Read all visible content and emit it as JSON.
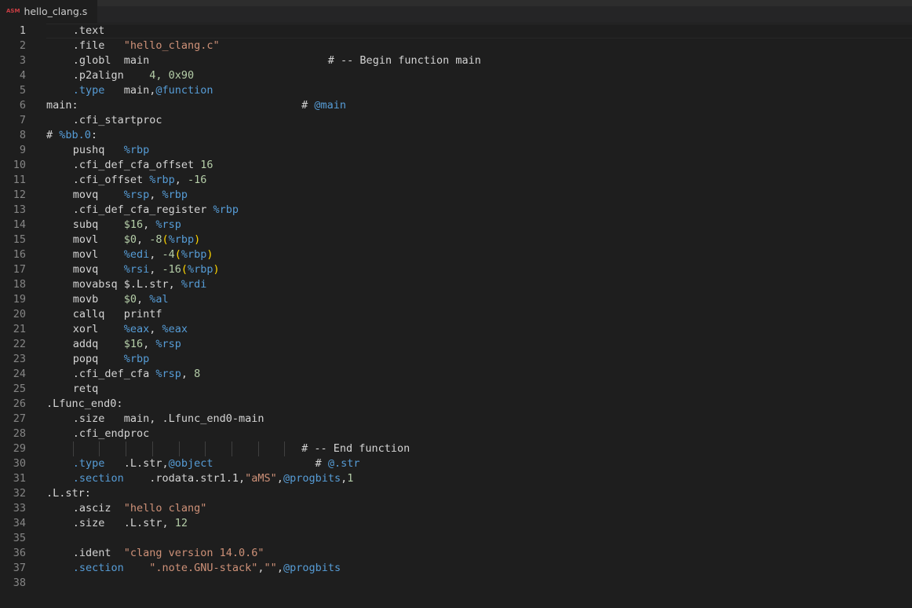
{
  "tab": {
    "icon_label": "ASM",
    "filename": "hello_clang.s"
  },
  "editor": {
    "current_line": 1,
    "lines": [
      {
        "n": "1",
        "indent": 1,
        "tokens": [
          [
            ".text",
            "txt"
          ]
        ]
      },
      {
        "n": "2",
        "indent": 1,
        "tokens": [
          [
            ".file   ",
            "txt"
          ],
          [
            "\"hello_clang.c\"",
            "str"
          ]
        ]
      },
      {
        "n": "3",
        "indent": 1,
        "tokens": [
          [
            ".globl  main                            # -- Begin function main",
            "txt"
          ]
        ]
      },
      {
        "n": "4",
        "indent": 1,
        "tokens": [
          [
            ".p2align    ",
            "txt"
          ],
          [
            "4, 0x90",
            "num"
          ]
        ]
      },
      {
        "n": "5",
        "indent": 1,
        "tokens": [
          [
            ".type",
            "reg"
          ],
          [
            "   main,",
            "txt"
          ],
          [
            "@function",
            "reg"
          ]
        ]
      },
      {
        "n": "6",
        "indent": 0,
        "tokens": [
          [
            "main:                                   # ",
            "txt"
          ],
          [
            "@main",
            "reg"
          ]
        ]
      },
      {
        "n": "7",
        "indent": 1,
        "tokens": [
          [
            ".cfi_startproc",
            "txt"
          ]
        ]
      },
      {
        "n": "8",
        "indent": 0,
        "tokens": [
          [
            "# ",
            "txt"
          ],
          [
            "%bb.0",
            "reg"
          ],
          [
            ":",
            "txt"
          ]
        ]
      },
      {
        "n": "9",
        "indent": 1,
        "tokens": [
          [
            "pushq   ",
            "txt"
          ],
          [
            "%rbp",
            "reg"
          ]
        ]
      },
      {
        "n": "10",
        "indent": 1,
        "tokens": [
          [
            ".cfi_def_cfa_offset ",
            "txt"
          ],
          [
            "16",
            "num"
          ]
        ]
      },
      {
        "n": "11",
        "indent": 1,
        "tokens": [
          [
            ".cfi_offset ",
            "txt"
          ],
          [
            "%rbp",
            "reg"
          ],
          [
            ", ",
            "txt"
          ],
          [
            "-16",
            "num"
          ]
        ]
      },
      {
        "n": "12",
        "indent": 1,
        "tokens": [
          [
            "movq    ",
            "txt"
          ],
          [
            "%rsp",
            "reg"
          ],
          [
            ", ",
            "txt"
          ],
          [
            "%rbp",
            "reg"
          ]
        ]
      },
      {
        "n": "13",
        "indent": 1,
        "tokens": [
          [
            ".cfi_def_cfa_register ",
            "txt"
          ],
          [
            "%rbp",
            "reg"
          ]
        ]
      },
      {
        "n": "14",
        "indent": 1,
        "tokens": [
          [
            "subq    ",
            "txt"
          ],
          [
            "$16",
            "num"
          ],
          [
            ", ",
            "txt"
          ],
          [
            "%rsp",
            "reg"
          ]
        ]
      },
      {
        "n": "15",
        "indent": 1,
        "tokens": [
          [
            "movl    ",
            "txt"
          ],
          [
            "$0",
            "num"
          ],
          [
            ", ",
            "txt"
          ],
          [
            "-8",
            "num"
          ],
          [
            "(",
            "brk"
          ],
          [
            "%rbp",
            "reg"
          ],
          [
            ")",
            "brk"
          ]
        ]
      },
      {
        "n": "16",
        "indent": 1,
        "tokens": [
          [
            "movl    ",
            "txt"
          ],
          [
            "%edi",
            "reg"
          ],
          [
            ", ",
            "txt"
          ],
          [
            "-4",
            "num"
          ],
          [
            "(",
            "brk"
          ],
          [
            "%rbp",
            "reg"
          ],
          [
            ")",
            "brk"
          ]
        ]
      },
      {
        "n": "17",
        "indent": 1,
        "tokens": [
          [
            "movq    ",
            "txt"
          ],
          [
            "%rsi",
            "reg"
          ],
          [
            ", ",
            "txt"
          ],
          [
            "-16",
            "num"
          ],
          [
            "(",
            "brk"
          ],
          [
            "%rbp",
            "reg"
          ],
          [
            ")",
            "brk"
          ]
        ]
      },
      {
        "n": "18",
        "indent": 1,
        "tokens": [
          [
            "movabsq ",
            "txt"
          ],
          [
            "$.L.str, ",
            "txt"
          ],
          [
            "%rdi",
            "reg"
          ]
        ]
      },
      {
        "n": "19",
        "indent": 1,
        "tokens": [
          [
            "movb    ",
            "txt"
          ],
          [
            "$0",
            "num"
          ],
          [
            ", ",
            "txt"
          ],
          [
            "%al",
            "reg"
          ]
        ]
      },
      {
        "n": "20",
        "indent": 1,
        "tokens": [
          [
            "callq   printf",
            "txt"
          ]
        ]
      },
      {
        "n": "21",
        "indent": 1,
        "tokens": [
          [
            "xorl    ",
            "txt"
          ],
          [
            "%eax",
            "reg"
          ],
          [
            ", ",
            "txt"
          ],
          [
            "%eax",
            "reg"
          ]
        ]
      },
      {
        "n": "22",
        "indent": 1,
        "tokens": [
          [
            "addq    ",
            "txt"
          ],
          [
            "$16",
            "num"
          ],
          [
            ", ",
            "txt"
          ],
          [
            "%rsp",
            "reg"
          ]
        ]
      },
      {
        "n": "23",
        "indent": 1,
        "tokens": [
          [
            "popq    ",
            "txt"
          ],
          [
            "%rbp",
            "reg"
          ]
        ]
      },
      {
        "n": "24",
        "indent": 1,
        "tokens": [
          [
            ".cfi_def_cfa ",
            "txt"
          ],
          [
            "%rsp",
            "reg"
          ],
          [
            ", ",
            "txt"
          ],
          [
            "8",
            "num"
          ]
        ]
      },
      {
        "n": "25",
        "indent": 1,
        "tokens": [
          [
            "retq",
            "txt"
          ]
        ]
      },
      {
        "n": "26",
        "indent": 0,
        "tokens": [
          [
            ".Lfunc_end0:",
            "txt"
          ]
        ]
      },
      {
        "n": "27",
        "indent": 1,
        "tokens": [
          [
            ".size   main, .Lfunc_end0-main",
            "txt"
          ]
        ]
      },
      {
        "n": "28",
        "indent": 1,
        "tokens": [
          [
            ".cfi_endproc",
            "txt"
          ]
        ]
      },
      {
        "n": "29",
        "indent": 0,
        "guides": 9,
        "tokens": [
          [
            "                                        # -- End function",
            "txt"
          ]
        ]
      },
      {
        "n": "30",
        "indent": 1,
        "tokens": [
          [
            ".type",
            "reg"
          ],
          [
            "   .L.str,",
            "txt"
          ],
          [
            "@object",
            "reg"
          ],
          [
            "                # ",
            "txt"
          ],
          [
            "@.str",
            "reg"
          ]
        ]
      },
      {
        "n": "31",
        "indent": 1,
        "tokens": [
          [
            ".section",
            "reg"
          ],
          [
            "    .rodata.str1.1,",
            "txt"
          ],
          [
            "\"aMS\"",
            "str"
          ],
          [
            ",",
            "txt"
          ],
          [
            "@progbits",
            "reg"
          ],
          [
            ",",
            "txt"
          ],
          [
            "1",
            "num"
          ]
        ]
      },
      {
        "n": "32",
        "indent": 0,
        "tokens": [
          [
            ".L.str:",
            "txt"
          ]
        ]
      },
      {
        "n": "33",
        "indent": 1,
        "tokens": [
          [
            ".asciz  ",
            "txt"
          ],
          [
            "\"hello clang\"",
            "str"
          ]
        ]
      },
      {
        "n": "34",
        "indent": 1,
        "tokens": [
          [
            ".size   .L.str, ",
            "txt"
          ],
          [
            "12",
            "num"
          ]
        ]
      },
      {
        "n": "35",
        "indent": 0,
        "tokens": []
      },
      {
        "n": "36",
        "indent": 1,
        "tokens": [
          [
            ".ident  ",
            "txt"
          ],
          [
            "\"clang version 14.0.6\"",
            "str"
          ]
        ]
      },
      {
        "n": "37",
        "indent": 1,
        "tokens": [
          [
            ".section",
            "reg"
          ],
          [
            "    ",
            "txt"
          ],
          [
            "\".note.GNU-stack\"",
            "str"
          ],
          [
            ",",
            "txt"
          ],
          [
            "\"\"",
            "str"
          ],
          [
            ",",
            "txt"
          ],
          [
            "@progbits",
            "reg"
          ]
        ]
      },
      {
        "n": "38",
        "indent": 0,
        "tokens": []
      }
    ]
  }
}
